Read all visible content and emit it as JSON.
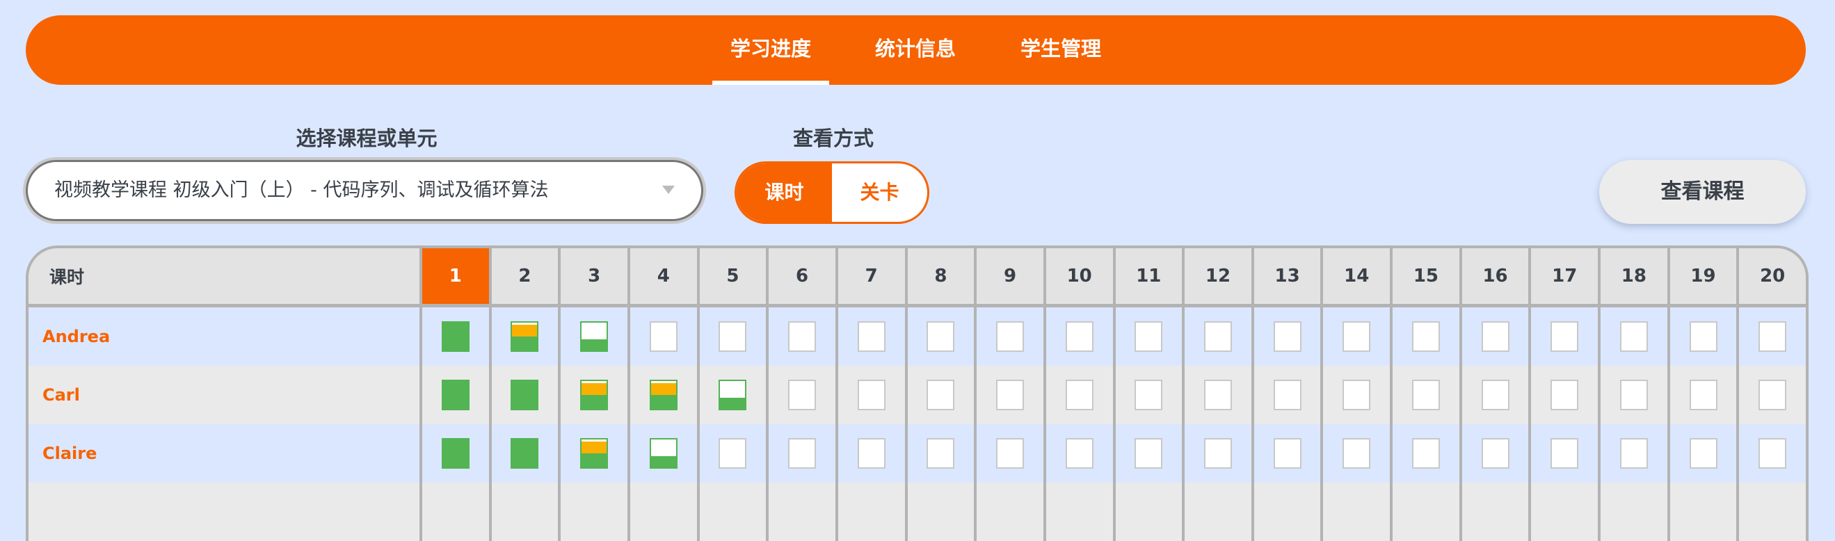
{
  "nav": {
    "tabs": [
      {
        "label": "学习进度",
        "active": true
      },
      {
        "label": "统计信息",
        "active": false
      },
      {
        "label": "学生管理",
        "active": false
      }
    ]
  },
  "course_select": {
    "label": "选择课程或单元",
    "value": "视频教学课程 初级入门（上） - 代码序列、调试及循环算法"
  },
  "view_mode": {
    "label": "查看方式",
    "options": [
      "课时",
      "关卡"
    ],
    "selected": "课时"
  },
  "view_course_button": "查看课程",
  "colors": {
    "accent": "#F76300",
    "completed": "#53B454",
    "in_progress": "#F9B000",
    "background": "#DBE7FE"
  },
  "table": {
    "header_label": "课时",
    "columns": [
      "1",
      "2",
      "3",
      "4",
      "5",
      "6",
      "7",
      "8",
      "9",
      "10",
      "11",
      "12",
      "13",
      "14",
      "15",
      "16",
      "17",
      "18",
      "19",
      "20"
    ],
    "current_column": "1",
    "legend_states": [
      "completed",
      "in-progress",
      "attempted",
      "not-started"
    ],
    "rows": [
      {
        "name": "Andrea",
        "progress": [
          "completed",
          "in-progress",
          "attempted",
          "not-started",
          "not-started",
          "not-started",
          "not-started",
          "not-started",
          "not-started",
          "not-started",
          "not-started",
          "not-started",
          "not-started",
          "not-started",
          "not-started",
          "not-started",
          "not-started",
          "not-started",
          "not-started",
          "not-started"
        ]
      },
      {
        "name": "Carl",
        "progress": [
          "completed",
          "completed",
          "in-progress",
          "in-progress",
          "attempted",
          "not-started",
          "not-started",
          "not-started",
          "not-started",
          "not-started",
          "not-started",
          "not-started",
          "not-started",
          "not-started",
          "not-started",
          "not-started",
          "not-started",
          "not-started",
          "not-started",
          "not-started"
        ]
      },
      {
        "name": "Claire",
        "progress": [
          "completed",
          "completed",
          "in-progress",
          "attempted",
          "not-started",
          "not-started",
          "not-started",
          "not-started",
          "not-started",
          "not-started",
          "not-started",
          "not-started",
          "not-started",
          "not-started",
          "not-started",
          "not-started",
          "not-started",
          "not-started",
          "not-started",
          "not-started"
        ]
      }
    ]
  }
}
